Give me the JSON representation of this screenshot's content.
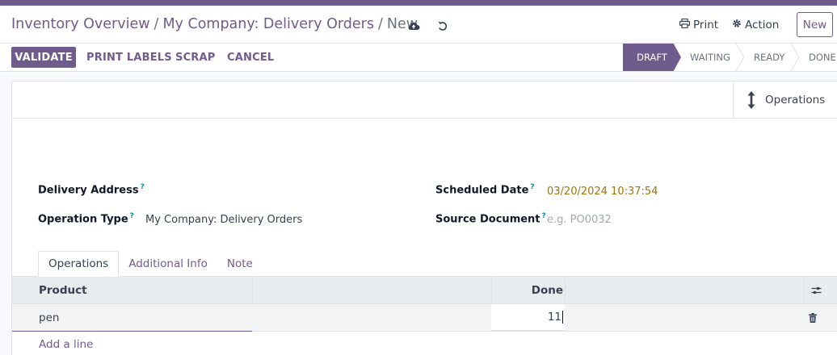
{
  "breadcrumb": {
    "items": [
      "Inventory Overview",
      "My Company: Delivery Orders"
    ],
    "separator": "/",
    "current": "New"
  },
  "header": {
    "print_label": "Print",
    "action_label": "Action",
    "new_label": "New"
  },
  "control_panel": {
    "validate_label": "VALIDATE",
    "print_labels_label": "PRINT LABELS",
    "scrap_label": "SCRAP",
    "cancel_label": "CANCEL"
  },
  "statusbar": {
    "stages": [
      "DRAFT",
      "WAITING",
      "READY",
      "DONE"
    ],
    "active": "DRAFT"
  },
  "smart_button": {
    "operations_label": "Operations"
  },
  "form": {
    "delivery_address_label": "Delivery Address",
    "operation_type_label": "Operation Type",
    "operation_type_value": "My Company: Delivery Orders",
    "scheduled_date_label": "Scheduled Date",
    "scheduled_date_value": "03/20/2024 10:37:54",
    "source_document_label": "Source Document",
    "source_document_placeholder": "e.g. PO0032",
    "help_marker": "?"
  },
  "tabs": [
    "Operations",
    "Additional Info",
    "Note"
  ],
  "table": {
    "columns": [
      "Product",
      "Done"
    ],
    "rows": [
      {
        "product": "pen",
        "done": "11"
      }
    ],
    "add_line_label": "Add a line"
  },
  "colors": {
    "brand": "#6f5c8d",
    "date": "#a0750a",
    "help": "#0891b2"
  }
}
